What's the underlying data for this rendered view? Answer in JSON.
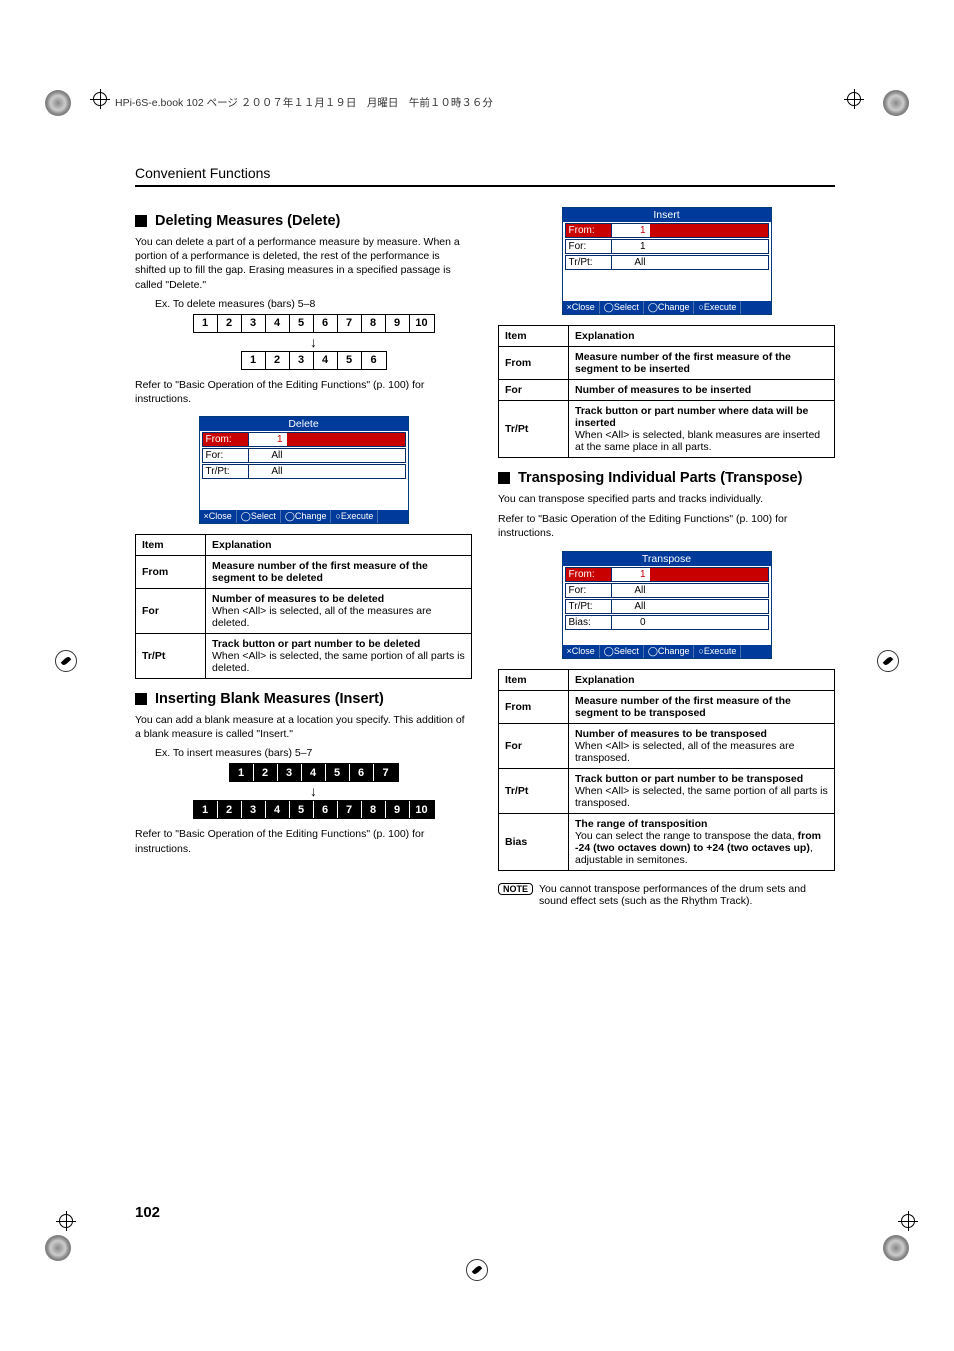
{
  "header_bar": "HPi-6S-e.book  102 ページ  ２００７年１１月１９日　月曜日　午前１０時３６分",
  "chapter": "Convenient Functions",
  "page_number": "102",
  "delete": {
    "title": "Deleting Measures (Delete)",
    "intro": "You can delete a part of a performance measure by measure. When a portion of a performance is deleted, the rest of the performance is shifted up to fill the gap. Erasing measures in a specified passage is called \"Delete.\"",
    "example_caption": "Ex. To delete measures (bars) 5–8",
    "cells_top": [
      "1",
      "2",
      "3",
      "4",
      "5",
      "6",
      "7",
      "8",
      "9",
      "10"
    ],
    "cells_bottom": [
      "1",
      "2",
      "3",
      "4",
      "5",
      "6"
    ],
    "ref": "Refer to \"Basic Operation of the Editing Functions\" (p. 100) for instructions.",
    "panel": {
      "title": "Delete",
      "rows": [
        {
          "label": "From:",
          "value": "1",
          "selected": true
        },
        {
          "label": "For:",
          "value": "All",
          "selected": false
        },
        {
          "label": "Tr/Pt:",
          "value": "All",
          "selected": false
        }
      ],
      "footer": [
        "×Close",
        "◯Select",
        "◯Change",
        "○Execute"
      ]
    },
    "table": {
      "header": [
        "Item",
        "Explanation"
      ],
      "rows": [
        {
          "item": "From",
          "text": "Measure number of the first measure of the segment to be deleted",
          "bold_all": true
        },
        {
          "item": "For",
          "lead": "Number of measures to be deleted",
          "rest": "When <All> is selected, all of the measures are deleted."
        },
        {
          "item": "Tr/Pt",
          "lead": "Track button or part number to be deleted",
          "rest": "When <All> is selected, the same portion of all parts is deleted."
        }
      ]
    }
  },
  "insert": {
    "title": "Inserting Blank Measures (Insert)",
    "intro": "You can add a blank measure at a location you specify. This addition of a blank measure is called \"Insert.\"",
    "example_caption": "Ex. To insert measures (bars) 5–7",
    "cells_top": [
      "1",
      "2",
      "3",
      "4",
      "5",
      "6",
      "7"
    ],
    "cells_bottom": [
      "1",
      "2",
      "3",
      "4",
      "5",
      "6",
      "7",
      "8",
      "9",
      "10"
    ],
    "ref": "Refer to \"Basic Operation of the Editing Functions\" (p. 100) for instructions.",
    "panel": {
      "title": "Insert",
      "rows": [
        {
          "label": "From:",
          "value": "1",
          "selected": true
        },
        {
          "label": "For:",
          "value": "1",
          "selected": false
        },
        {
          "label": "Tr/Pt:",
          "value": "All",
          "selected": false
        }
      ],
      "footer": [
        "×Close",
        "◯Select",
        "◯Change",
        "○Execute"
      ]
    },
    "table": {
      "header": [
        "Item",
        "Explanation"
      ],
      "rows": [
        {
          "item": "From",
          "text": "Measure number of the first measure of the segment to be inserted",
          "bold_all": true
        },
        {
          "item": "For",
          "text": "Number of measures to be inserted",
          "bold_all": true
        },
        {
          "item": "Tr/Pt",
          "lead": "Track button or part number where data will be inserted",
          "rest": "When <All> is selected, blank measures are inserted at the same place in all parts."
        }
      ]
    }
  },
  "transpose": {
    "title": "Transposing Individual Parts (Transpose)",
    "intro1": "You can transpose specified parts and tracks individually.",
    "ref": "Refer to \"Basic Operation of the Editing Functions\" (p. 100) for instructions.",
    "panel": {
      "title": "Transpose",
      "rows": [
        {
          "label": "From:",
          "value": "1",
          "selected": true
        },
        {
          "label": "For:",
          "value": "All",
          "selected": false
        },
        {
          "label": "Tr/Pt:",
          "value": "All",
          "selected": false
        },
        {
          "label": "Bias:",
          "value": "0",
          "selected": false
        }
      ],
      "footer": [
        "×Close",
        "◯Select",
        "◯Change",
        "○Execute"
      ]
    },
    "table": {
      "header": [
        "Item",
        "Explanation"
      ],
      "rows": [
        {
          "item": "From",
          "text": "Measure number of the first measure of the segment to be transposed",
          "bold_all": true
        },
        {
          "item": "For",
          "lead": "Number of measures to be transposed",
          "rest": "When <All> is selected, all of the measures are transposed."
        },
        {
          "item": "Tr/Pt",
          "lead": "Track button or part number to be transposed",
          "rest": "When <All> is selected, the same portion of all parts is transposed."
        },
        {
          "item": "Bias",
          "lead": "The range of transposition",
          "mid": "You can select the range to transpose the data, ",
          "bold2": "from -24 (two octaves down) to +24 (two octaves up)",
          "tail": ", adjustable in semitones."
        }
      ]
    },
    "note_label": "NOTE",
    "note_text": "You cannot transpose performances of the drum sets and sound effect sets (such as the Rhythm Track)."
  }
}
